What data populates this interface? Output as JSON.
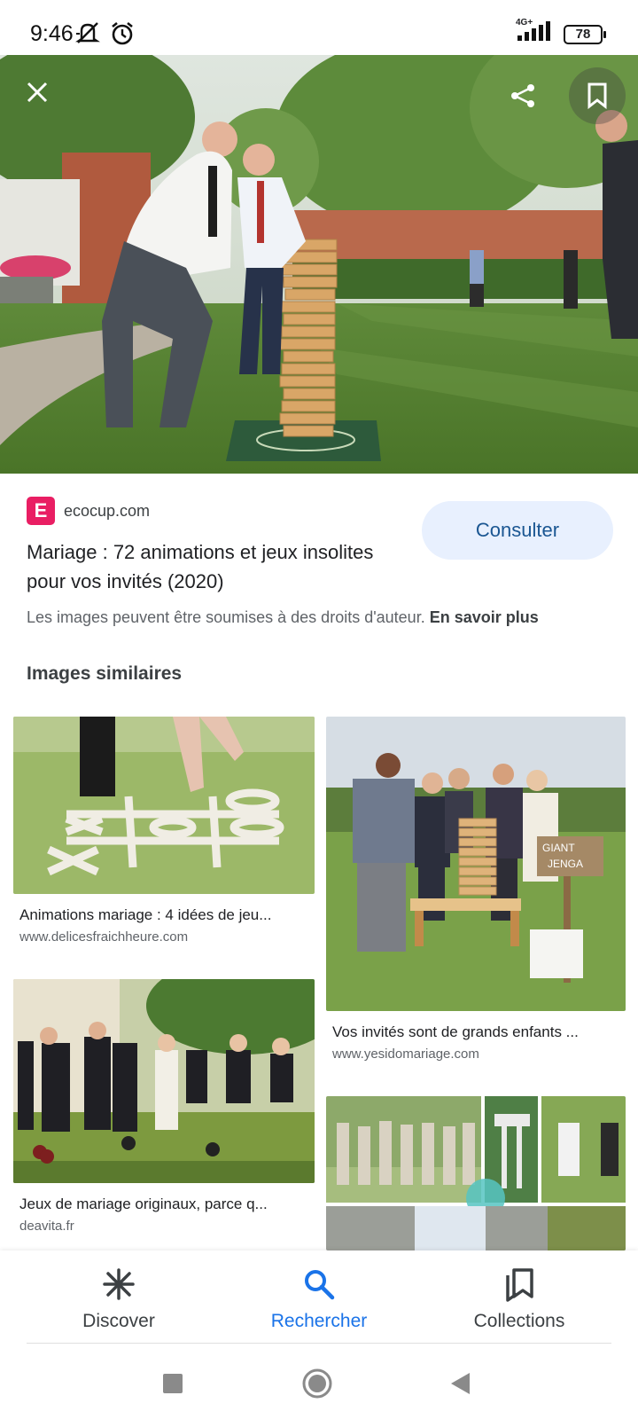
{
  "status_bar": {
    "time": "9:46",
    "network": "4G+",
    "battery": "78"
  },
  "hero": {
    "image_alt": "Giant jenga game at an outdoor wedding"
  },
  "result": {
    "favicon_letter": "E",
    "domain": "ecocup.com",
    "title": "Mariage : 72 animations et jeux insolites pour vos invités (2020)",
    "visit_label": "Consulter",
    "copyright_text": "Les images peuvent être soumises à des droits d'auteur.",
    "learn_more": "En savoir plus"
  },
  "similar": {
    "heading": "Images similaires",
    "items": [
      {
        "title": "Animations mariage : 4 idées de jeu...",
        "domain": "www.delicesfraichheure.com"
      },
      {
        "title": "Vos invités sont de grands enfants ...",
        "domain": "www.yesidomariage.com"
      },
      {
        "title": "Jeux de mariage originaux, parce q...",
        "domain": "deavita.fr"
      },
      {
        "title": "",
        "domain": ""
      }
    ],
    "sign_text_1": "GIANT",
    "sign_text_2": "JENGA"
  },
  "bottom_nav": {
    "items": [
      {
        "label": "Discover",
        "icon": "asterisk-icon"
      },
      {
        "label": "Rechercher",
        "icon": "search-icon",
        "active": true
      },
      {
        "label": "Collections",
        "icon": "collections-icon"
      }
    ]
  },
  "colors": {
    "accent": "#1a73e8",
    "visit_bg": "#e8f0fe",
    "favicon": "#e91e63"
  }
}
